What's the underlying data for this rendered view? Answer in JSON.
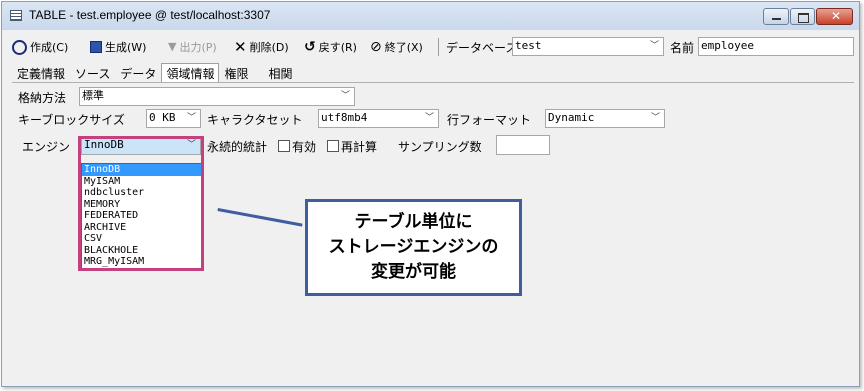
{
  "window": {
    "title": "TABLE - test.employee @ test/localhost:3307"
  },
  "toolbar": {
    "create": "作成(C)",
    "generate": "生成(W)",
    "output": "出力(P)",
    "delete": "削除(D)",
    "revert": "戻す(R)",
    "exit": "終了(X)",
    "database_label": "データベース",
    "database_value": "test",
    "name_label": "名前",
    "name_value": "employee"
  },
  "tabs": [
    "定義情報",
    "ソース",
    "データ",
    "領域情報",
    "権限",
    "相関"
  ],
  "active_tab": "領域情報",
  "form": {
    "storage_label": "格納方法",
    "storage_value": "標準",
    "keyblock_label": "キーブロックサイズ",
    "keyblock_value": "0 KB",
    "charset_label": "キャラクタセット",
    "charset_value": "utf8mb4",
    "rowformat_label": "行フォーマット",
    "rowformat_value": "Dynamic",
    "engine_label": "エンジン",
    "engine_value": "InnoDB",
    "persistent_label": "永続的統計",
    "enabled_label": "有効",
    "recalc_label": "再計算",
    "sampling_label": "サンプリング数",
    "sampling_value": ""
  },
  "engine_options": [
    "InnoDB",
    "MyISAM",
    "ndbcluster",
    "MEMORY",
    "FEDERATED",
    "ARCHIVE",
    "CSV",
    "BLACKHOLE",
    "MRG_MyISAM"
  ],
  "callout": {
    "line1": "テーブル単位に",
    "line2": "ストレージエンジンの",
    "line3": "変更が可能"
  },
  "colors": {
    "highlight": "#c5407f",
    "callout_border": "#3f5da0",
    "selection": "#3399ff"
  }
}
